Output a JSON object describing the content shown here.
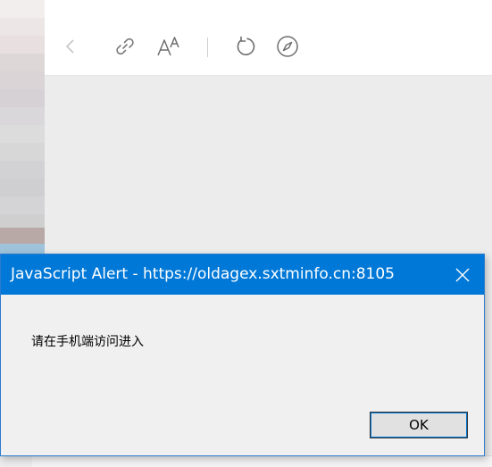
{
  "toolbar": {
    "icons": [
      "back-icon",
      "link-icon",
      "text-size-icon",
      "refresh-icon",
      "compass-icon"
    ]
  },
  "dialog": {
    "title": "JavaScript Alert - https://oldagex.sxtminfo.cn:8105",
    "message": "请在手机端访问进入",
    "ok_label": "OK"
  },
  "colors": {
    "titlebar": "#0078d7",
    "dialog_bg": "#f0f0f0",
    "content_bg": "#ececec"
  }
}
